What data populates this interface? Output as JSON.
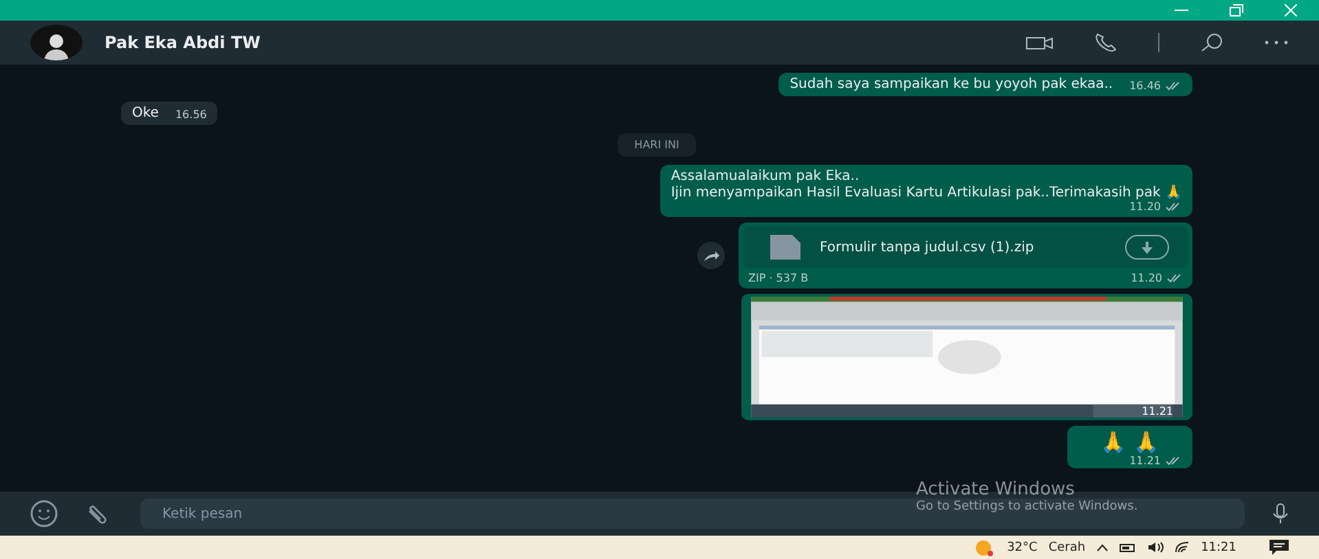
{
  "header": {
    "contact": "Pak Eka Abdi TW"
  },
  "messages": [
    {
      "kind": "text",
      "outgoing": true,
      "text": "Sudah saya sampaikan ke bu yoyoh pak ekaa..",
      "time": "16.46"
    },
    {
      "kind": "text",
      "outgoing": false,
      "text": "Oke",
      "time": "16.56"
    },
    {
      "kind": "date",
      "text": "HARI INI"
    },
    {
      "kind": "text",
      "outgoing": true,
      "lines": [
        "Assalamualaikum pak Eka..",
        "Ijin menyampaikan Hasil Evaluasi Kartu Artikulasi pak..Terimakasih pak 🙏"
      ],
      "time": "11.20"
    },
    {
      "kind": "file",
      "outgoing": true,
      "filename": "Formulir tanpa judul.csv (1).zip",
      "meta": "ZIP · 537 B",
      "time": "11.20"
    },
    {
      "outgoing": true,
      "time": "11.21"
    },
    {
      "kind": "emoji",
      "outgoing": true,
      "text": "🙏 🙏",
      "time": "11.21"
    }
  ],
  "composer": {
    "placeholder": "Ketik pesan"
  },
  "activation": {
    "title": "Activate Windows",
    "subtitle": "Go to Settings to activate Windows."
  },
  "taskbar": {
    "weather": "32°C",
    "condition": "Cerah",
    "clock": "11:21"
  }
}
